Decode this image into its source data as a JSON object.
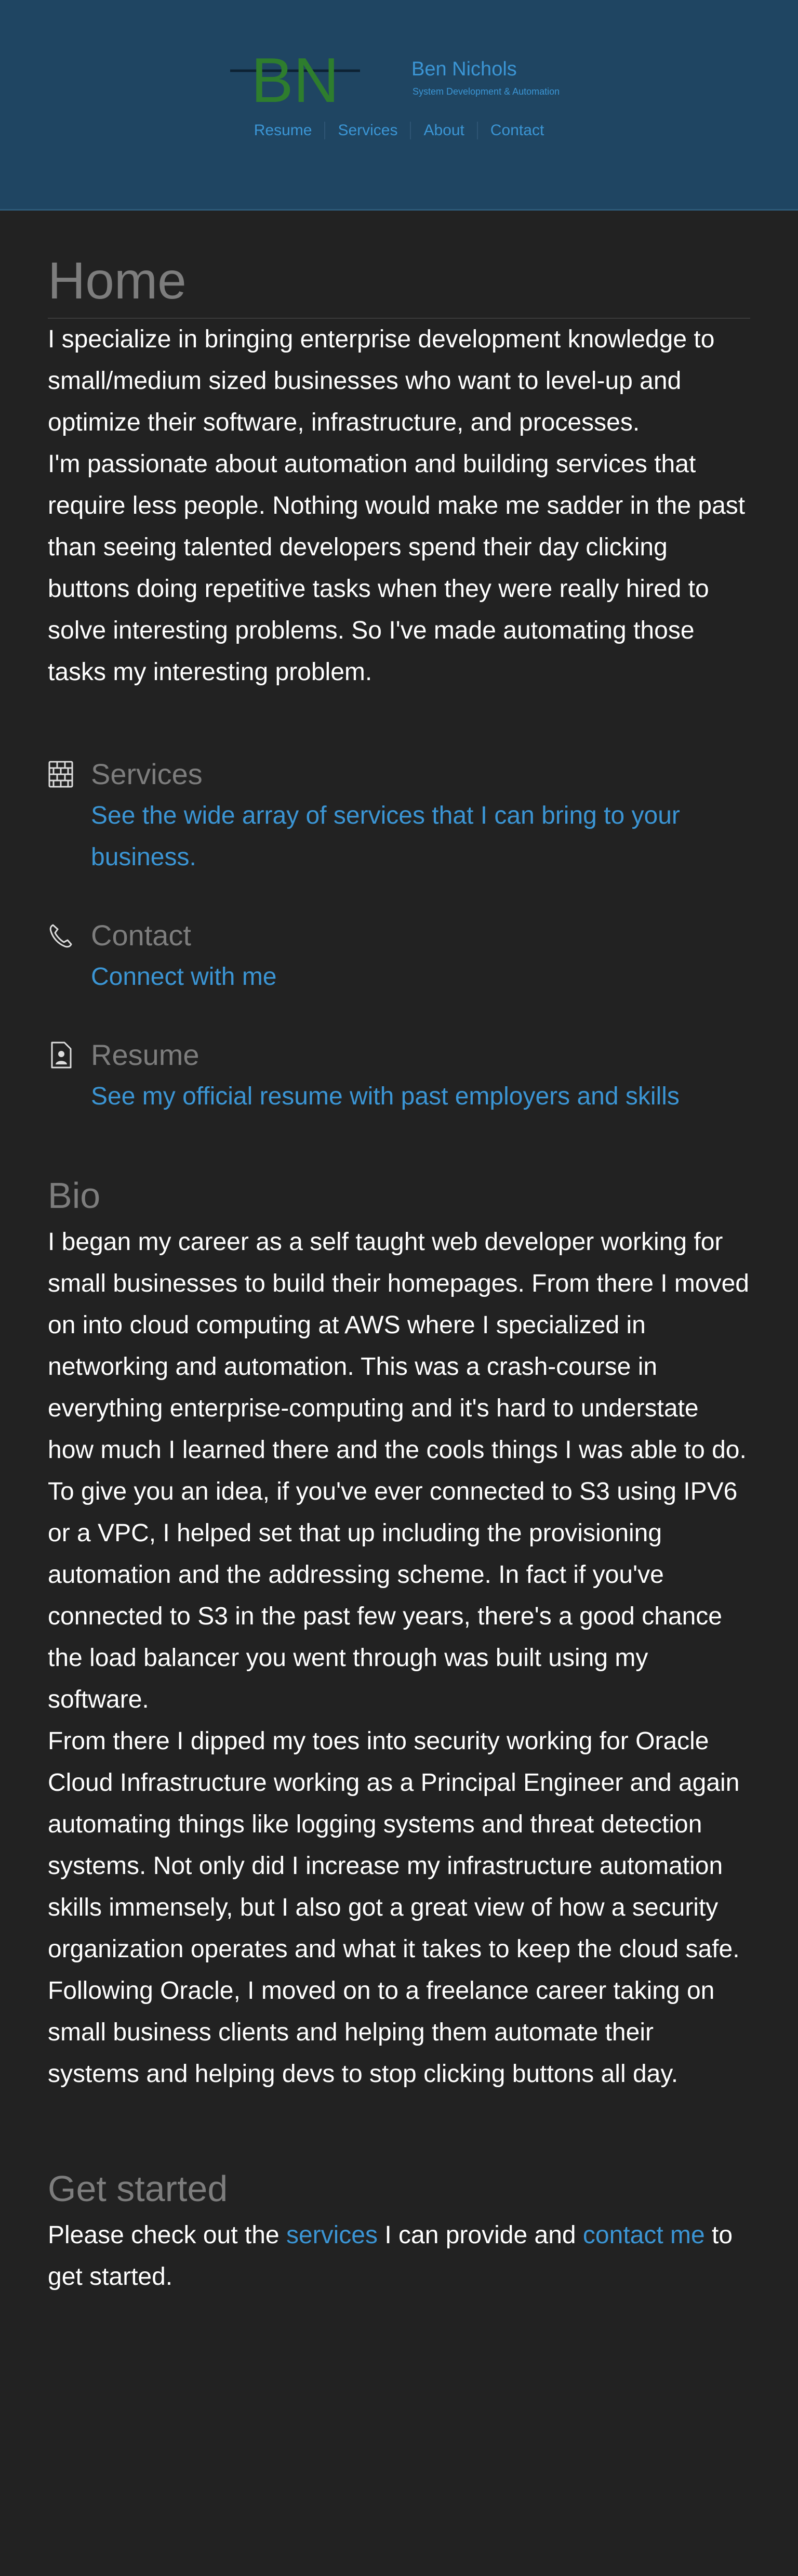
{
  "header": {
    "logo_text": "BN",
    "name": "Ben Nichols",
    "tagline": "System Development & Automation",
    "nav": [
      {
        "label": "Resume"
      },
      {
        "label": "Services"
      },
      {
        "label": "About"
      },
      {
        "label": "Contact"
      }
    ],
    "colors": {
      "background": "#1f4562",
      "link": "#3b95d4",
      "logo_green": "#2e7d2e"
    }
  },
  "home": {
    "title": "Home",
    "intro": [
      "I specialize in bringing enterprise development knowledge to small/medium sized businesses who want to level-up and optimize their software, infrastructure, and processes.",
      "I'm passionate about automation and building services that require less people. Nothing would make me sadder in the past than seeing talented developers spend their day clicking buttons doing repetitive tasks when they were really hired to solve interesting problems. So I've made automating those tasks my interesting problem."
    ]
  },
  "links": [
    {
      "icon": "brick-wall-icon",
      "title": "Services",
      "link": "See the wide array of services that I can bring to your business."
    },
    {
      "icon": "phone-icon",
      "title": "Contact",
      "link": "Connect with me"
    },
    {
      "icon": "resume-file-icon",
      "title": "Resume",
      "link": "See my official resume with past employers and skills"
    }
  ],
  "bio": {
    "title": "Bio",
    "paragraphs": [
      "I began my career as a self taught web developer working for small businesses to build their homepages. From there I moved on into cloud computing at AWS where I specialized in networking and automation. This was a crash-course in everything enterprise-computing and it's hard to understate how much I learned there and the cools things I was able to do. To give you an idea, if you've ever connected to S3 using IPV6 or a VPC, I helped set that up including the provisioning automation and the addressing scheme. In fact if you've connected to S3 in the past few years, there's a good chance the load balancer you went through was built using my software.",
      "From there I dipped my toes into security working for Oracle Cloud Infrastructure working as a Principal Engineer and again automating things like logging systems and threat detection systems. Not only did I increase my infrastructure automation skills immensely, but I also got a great view of how a security organization operates and what it takes to keep the cloud safe.",
      "Following Oracle, I moved on to a freelance career taking on small business clients and helping them automate their systems and helping devs to stop clicking buttons all day."
    ]
  },
  "get_started": {
    "title": "Get started",
    "text_1": "Please check out the ",
    "link_services": "services",
    "text_2": " I can provide and ",
    "link_contact": "contact me",
    "text_3": " to get started."
  }
}
